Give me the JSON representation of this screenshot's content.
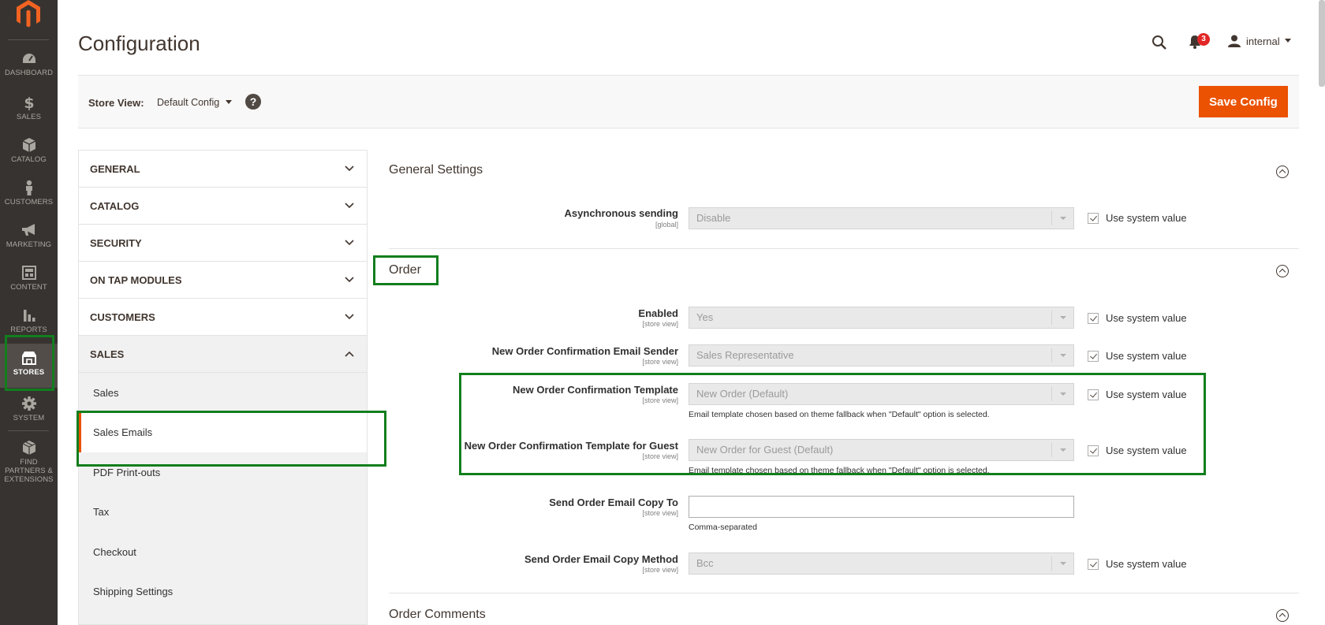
{
  "nav": {
    "items": [
      {
        "key": "dashboard",
        "label": "DASHBOARD",
        "icon": "gauge-icon"
      },
      {
        "key": "sales",
        "label": "SALES",
        "icon": "dollar-icon"
      },
      {
        "key": "catalog",
        "label": "CATALOG",
        "icon": "box-icon"
      },
      {
        "key": "customers",
        "label": "CUSTOMERS",
        "icon": "person-icon"
      },
      {
        "key": "marketing",
        "label": "MARKETING",
        "icon": "megaphone-icon"
      },
      {
        "key": "content",
        "label": "CONTENT",
        "icon": "layout-icon"
      },
      {
        "key": "reports",
        "label": "REPORTS",
        "icon": "bar-chart-icon"
      },
      {
        "key": "stores",
        "label": "STORES",
        "icon": "storefront-icon"
      },
      {
        "key": "system",
        "label": "SYSTEM",
        "icon": "gear-icon"
      },
      {
        "key": "partners",
        "label": "FIND PARTNERS & EXTENSIONS",
        "icon": "cube-icon"
      }
    ],
    "active": "stores"
  },
  "header": {
    "title": "Configuration",
    "notification_count": "3",
    "user": "internal"
  },
  "store_view": {
    "label": "Store View:",
    "value": "Default Config",
    "help": "?"
  },
  "save_button": "Save Config",
  "tabs": {
    "groups": [
      "GENERAL",
      "CATALOG",
      "SECURITY",
      "ON TAP MODULES",
      "CUSTOMERS",
      "SALES"
    ],
    "sales_items": [
      "Sales",
      "Sales Emails",
      "PDF Print-outs",
      "Tax",
      "Checkout",
      "Shipping Settings"
    ]
  },
  "sections": {
    "general": {
      "title": "General Settings",
      "async_label": "Asynchronous sending",
      "async_scope": "[global]",
      "async_value": "Disable"
    },
    "order": {
      "title": "Order",
      "enabled_label": "Enabled",
      "enabled_value": "Yes",
      "sender_label": "New Order Confirmation Email Sender",
      "sender_value": "Sales Representative",
      "template_label": "New Order Confirmation Template",
      "template_value": "New Order (Default)",
      "template_note": "Email template chosen based on theme fallback when \"Default\" option is selected.",
      "guest_label": "New Order Confirmation Template for Guest",
      "guest_value": "New Order for Guest (Default)",
      "guest_note": "Email template chosen based on theme fallback when \"Default\" option is selected.",
      "copy_to_label": "Send Order Email Copy To",
      "copy_to_value": "",
      "copy_to_note": "Comma-separated",
      "copy_method_label": "Send Order Email Copy Method",
      "copy_method_value": "Bcc",
      "scope_store_view": "[store view]"
    },
    "comments": {
      "title": "Order Comments"
    }
  },
  "use_system_value": "Use system value",
  "colors": {
    "nav_bg": "#373330",
    "accent": "#eb5202",
    "highlight": "#127e1d"
  }
}
